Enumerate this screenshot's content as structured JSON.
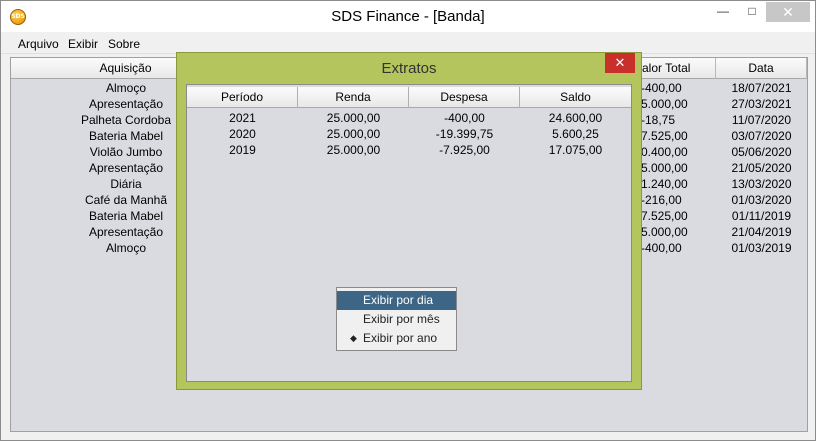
{
  "window": {
    "title": "SDS Finance - [Banda]",
    "icon_text": "SDS",
    "minimize_glyph": "—",
    "maximize_glyph": "□",
    "close_glyph": "✕"
  },
  "menu": {
    "items": [
      "Arquivo",
      "Exibir",
      "Sobre"
    ]
  },
  "background_table": {
    "headers": [
      "Aquisição",
      "alor Total",
      "Data"
    ],
    "rows": [
      [
        "Almoço",
        "-400,00",
        "18/07/2021"
      ],
      [
        "Apresentação",
        "5.000,00",
        "27/03/2021"
      ],
      [
        "Palheta Cordoba",
        "-18,75",
        "11/07/2020"
      ],
      [
        "Bateria Mabel",
        "7.525,00",
        "03/07/2020"
      ],
      [
        "Violão Jumbo",
        "0.400,00",
        "05/06/2020"
      ],
      [
        "Apresentação",
        "5.000,00",
        "21/05/2020"
      ],
      [
        "Diária",
        "1.240,00",
        "13/03/2020"
      ],
      [
        "Café da Manhã",
        "-216,00",
        "01/03/2020"
      ],
      [
        "Bateria Mabel",
        "7.525,00",
        "01/11/2019"
      ],
      [
        "Apresentação",
        "5.000,00",
        "21/04/2019"
      ],
      [
        "Almoço",
        "-400,00",
        "01/03/2019"
      ]
    ]
  },
  "dialog": {
    "title": "Extratos",
    "close_glyph": "✕",
    "headers": [
      "Período",
      "Renda",
      "Despesa",
      "Saldo"
    ],
    "rows": [
      [
        "2021",
        "25.000,00",
        "-400,00",
        "24.600,00"
      ],
      [
        "2020",
        "25.000,00",
        "-19.399,75",
        "5.600,25"
      ],
      [
        "2019",
        "25.000,00",
        "-7.925,00",
        "17.075,00"
      ]
    ]
  },
  "context_menu": {
    "items": [
      {
        "label": "Exibir por dia",
        "highlighted": true,
        "checked": false
      },
      {
        "label": "Exibir por mês",
        "highlighted": false,
        "checked": false
      },
      {
        "label": "Exibir por ano",
        "highlighted": false,
        "checked": true
      }
    ],
    "check_glyph": "◆"
  },
  "colors": {
    "dialog_frame": "#b4c55e",
    "table_bg": "#d9dbe1",
    "menu_highlight": "#3d6585",
    "dialog_close": "#c9302c"
  }
}
